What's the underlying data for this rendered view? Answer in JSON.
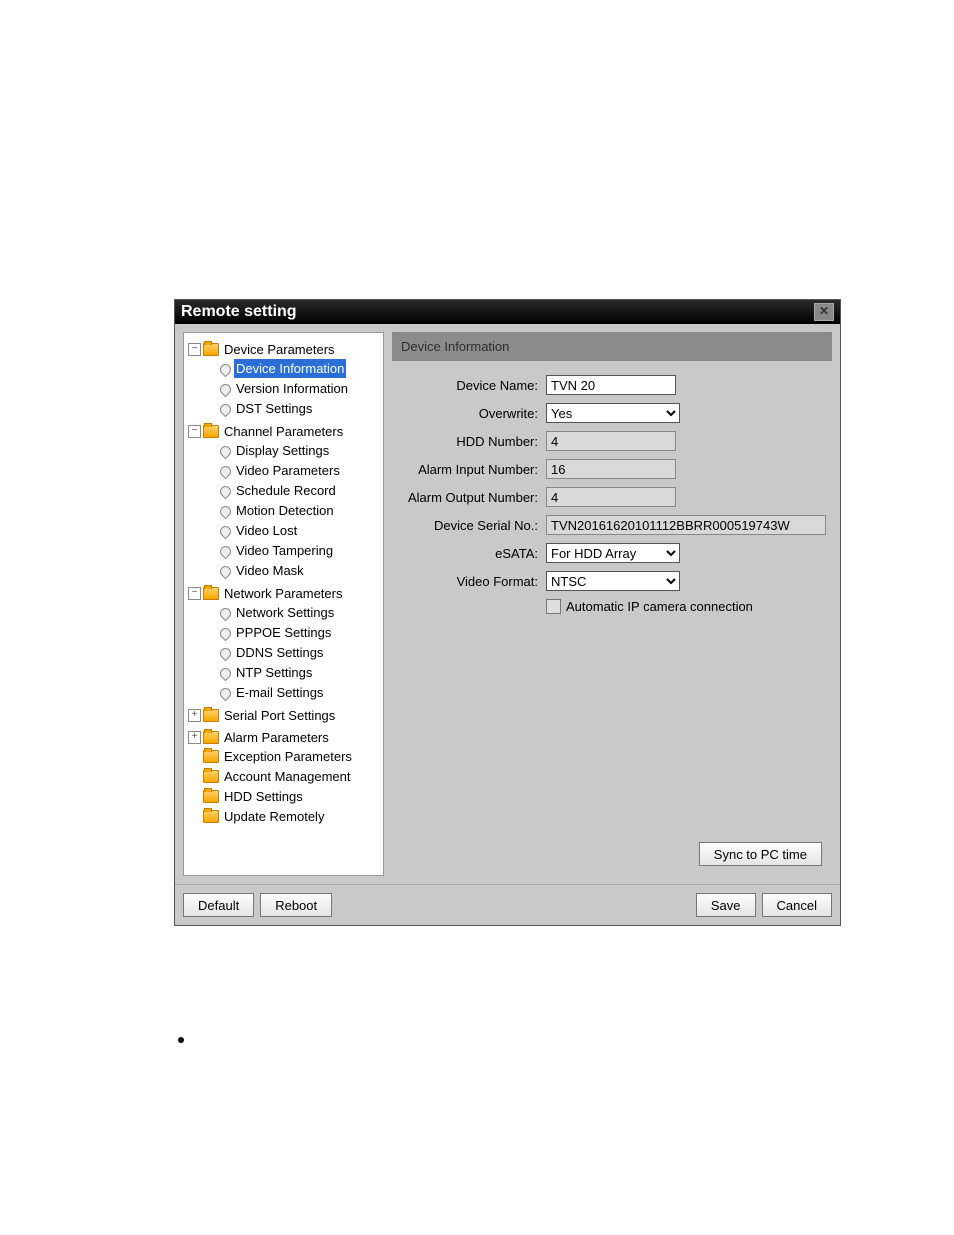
{
  "window": {
    "title": "Remote setting"
  },
  "tree": {
    "device_params": {
      "label": "Device Parameters",
      "children": {
        "device_info": "Device Information",
        "version_info": "Version Information",
        "dst": "DST Settings"
      }
    },
    "channel_params": {
      "label": "Channel Parameters",
      "children": {
        "display": "Display Settings",
        "video_params": "Video Parameters",
        "schedule": "Schedule Record",
        "motion": "Motion Detection",
        "vlost": "Video Lost",
        "vtamper": "Video Tampering",
        "vmask": "Video Mask"
      }
    },
    "network_params": {
      "label": "Network Parameters",
      "children": {
        "net": "Network Settings",
        "pppoe": "PPPOE Settings",
        "ddns": "DDNS Settings",
        "ntp": "NTP Settings",
        "email": "E-mail Settings"
      }
    },
    "serial": "Serial Port Settings",
    "alarm": "Alarm Parameters",
    "exception": "Exception Parameters",
    "account": "Account Management",
    "hdd": "HDD Settings",
    "update": "Update Remotely"
  },
  "panel": {
    "header": "Device Information",
    "labels": {
      "device_name": "Device Name:",
      "overwrite": "Overwrite:",
      "hdd_num": "HDD Number:",
      "alarm_in": "Alarm Input Number:",
      "alarm_out": "Alarm Output Number:",
      "serial": "Device Serial No.:",
      "esata": "eSATA:",
      "vformat": "Video Format:",
      "auto_ip": "Automatic IP camera connection",
      "sync": "Sync to PC time"
    },
    "values": {
      "device_name": "TVN 20",
      "overwrite": "Yes",
      "hdd_num": "4",
      "alarm_in": "16",
      "alarm_out": "4",
      "serial": "TVN20161620101112BBRR000519743W",
      "esata": "For HDD Array",
      "vformat": "NTSC"
    }
  },
  "buttons": {
    "default": "Default",
    "reboot": "Reboot",
    "save": "Save",
    "cancel": "Cancel"
  }
}
